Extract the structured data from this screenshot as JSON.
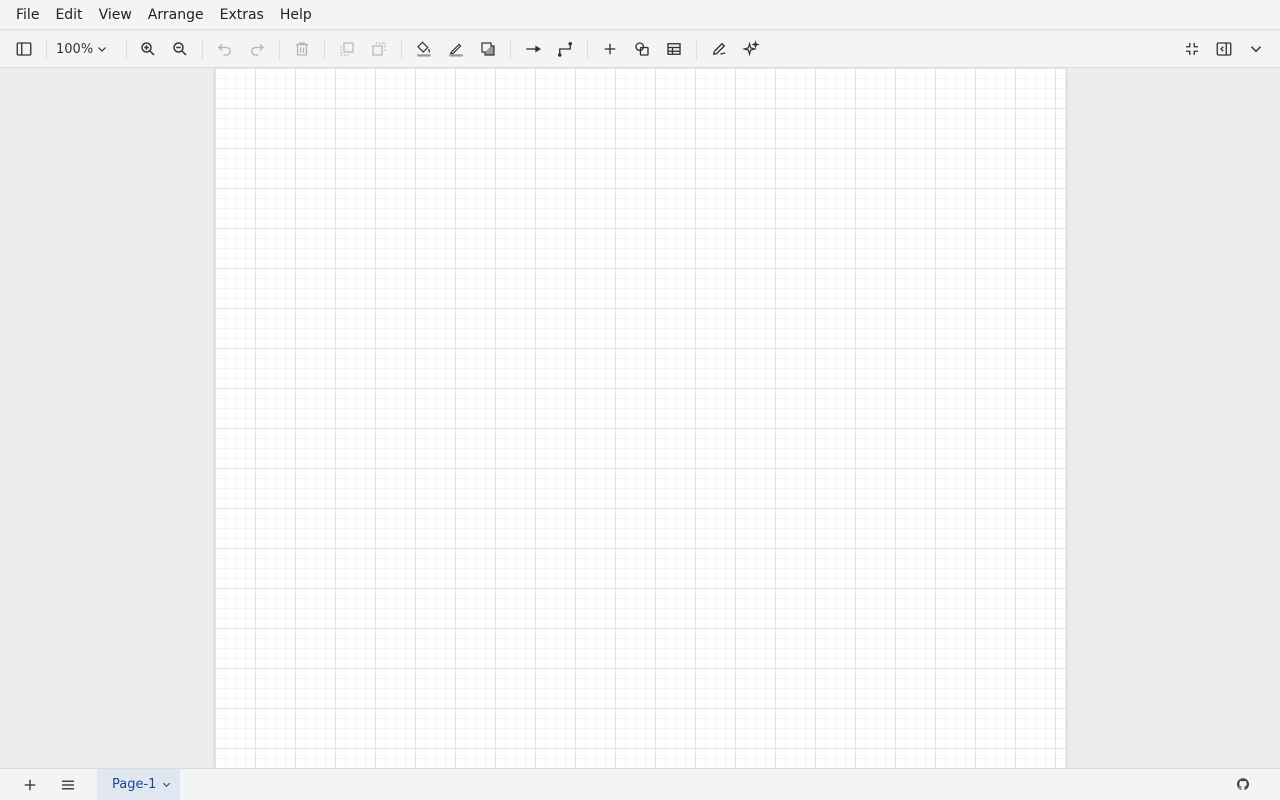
{
  "menu": {
    "items": [
      "File",
      "Edit",
      "View",
      "Arrange",
      "Extras",
      "Help"
    ]
  },
  "toolbar": {
    "zoom_level": "100%",
    "icons": {
      "format_panel": "sidebar-toggle-icon",
      "zoom_in": "zoom-in-icon",
      "zoom_out": "zoom-out-icon",
      "undo": "undo-icon",
      "redo": "redo-icon",
      "delete": "trash-icon",
      "to_front": "to-front-icon",
      "to_back": "to-back-icon",
      "fill_color": "fill-color-icon",
      "line_color": "line-color-icon",
      "shadow": "shadow-icon",
      "connection": "arrow-right-icon",
      "waypoints": "orthogonal-connector-icon",
      "insert": "plus-icon",
      "shapes": "shapes-icon",
      "table": "table-icon",
      "freehand": "pencil-icon",
      "generate": "sparkles-icon",
      "fullscreen": "fullscreen-icon",
      "toggle_format": "format-panel-icon",
      "collapse": "chevron-down-icon"
    }
  },
  "footer": {
    "page_tab_label": "Page-1",
    "icons": {
      "add_page": "plus-icon",
      "pages_menu": "hamburger-icon",
      "status": "github-icon"
    }
  },
  "colors": {
    "chrome_bg": "#f3f4f6",
    "canvas_bg": "#ececec",
    "page_bg": "#ffffff",
    "grid_major": "#e4e4e4",
    "page_tab_bg": "#e0e7f1",
    "page_tab_text": "#1a4a8a",
    "disabled_icon": "#b4b4b4"
  }
}
